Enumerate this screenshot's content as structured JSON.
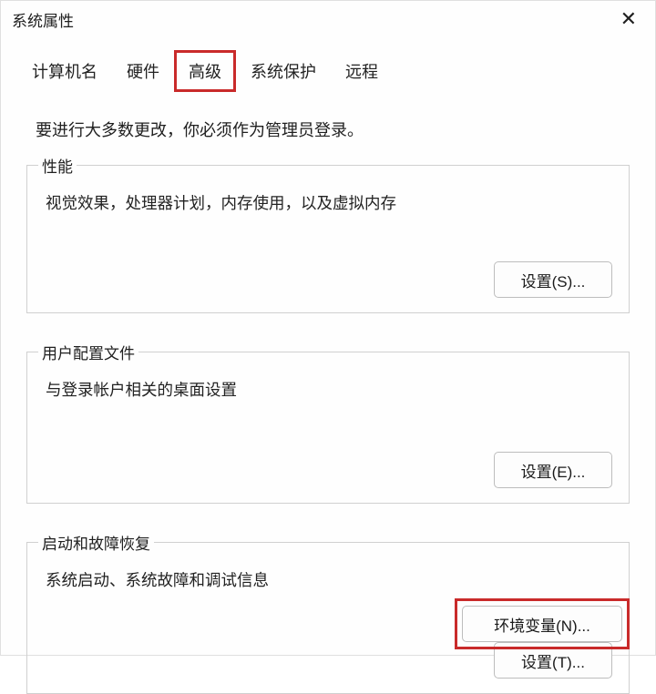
{
  "window": {
    "title": "系统属性"
  },
  "tabs": [
    {
      "label": "计算机名",
      "key": "computer-name"
    },
    {
      "label": "硬件",
      "key": "hardware"
    },
    {
      "label": "高级",
      "key": "advanced",
      "highlighted": true
    },
    {
      "label": "系统保护",
      "key": "system-protection"
    },
    {
      "label": "远程",
      "key": "remote"
    }
  ],
  "admin_note": "要进行大多数更改，你必须作为管理员登录。",
  "groups": {
    "performance": {
      "legend": "性能",
      "desc": "视觉效果，处理器计划，内存使用，以及虚拟内存",
      "button": "设置(S)..."
    },
    "user_profile": {
      "legend": "用户配置文件",
      "desc": "与登录帐户相关的桌面设置",
      "button": "设置(E)..."
    },
    "startup": {
      "legend": "启动和故障恢复",
      "desc": "系统启动、系统故障和调试信息",
      "button": "设置(T)..."
    }
  },
  "bottom": {
    "env_vars_button": "环境变量(N)..."
  },
  "highlight_color": "#c92a2a"
}
